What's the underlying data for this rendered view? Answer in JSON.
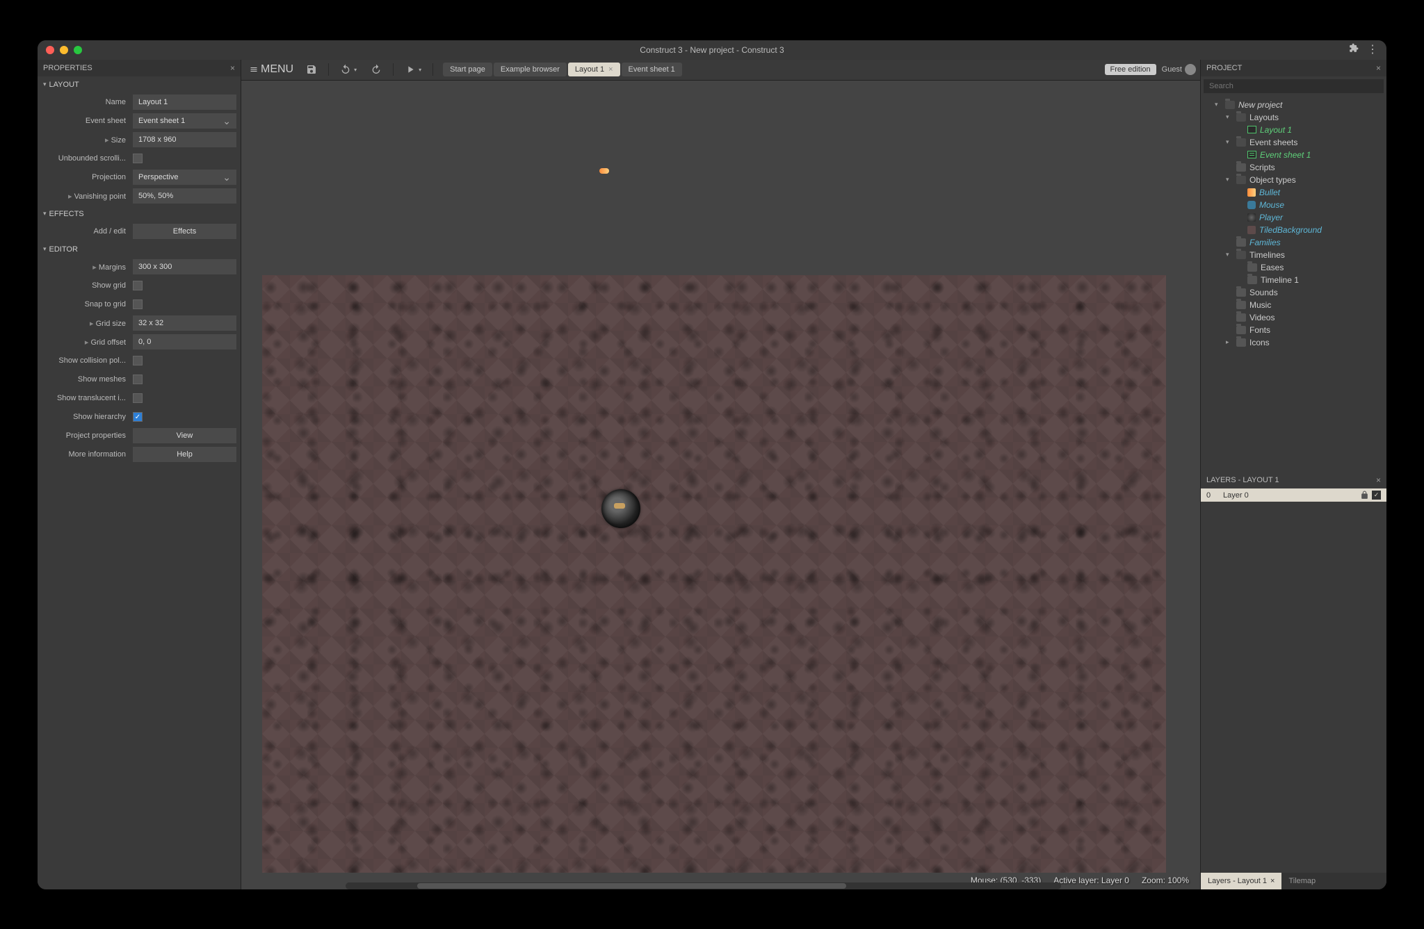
{
  "window": {
    "title": "Construct 3 - New project - Construct 3"
  },
  "properties": {
    "title": "PROPERTIES",
    "sections": {
      "layout": {
        "title": "LAYOUT",
        "name_label": "Name",
        "name_value": "Layout 1",
        "eventsheet_label": "Event sheet",
        "eventsheet_value": "Event sheet 1",
        "size_label": "Size",
        "size_value": "1708 x 960",
        "unbounded_label": "Unbounded scrolli...",
        "projection_label": "Projection",
        "projection_value": "Perspective",
        "vanishing_label": "Vanishing point",
        "vanishing_value": "50%, 50%"
      },
      "effects": {
        "title": "EFFECTS",
        "addedit_label": "Add / edit",
        "effects_btn": "Effects"
      },
      "editor": {
        "title": "EDITOR",
        "margins_label": "Margins",
        "margins_value": "300 x 300",
        "showgrid_label": "Show grid",
        "snap_label": "Snap to grid",
        "gridsize_label": "Grid size",
        "gridsize_value": "32 x 32",
        "gridoffset_label": "Grid offset",
        "gridoffset_value": "0, 0",
        "collision_label": "Show collision pol...",
        "meshes_label": "Show meshes",
        "translucent_label": "Show translucent i...",
        "hierarchy_label": "Show hierarchy",
        "projprops_label": "Project properties",
        "view_btn": "View",
        "moreinfo_label": "More information",
        "help_btn": "Help"
      }
    }
  },
  "toolbar": {
    "menu": "MENU",
    "tabs": {
      "start": "Start page",
      "examples": "Example browser",
      "layout": "Layout 1",
      "event": "Event sheet 1"
    },
    "free": "Free edition",
    "guest": "Guest"
  },
  "status": {
    "mouse": "Mouse: (530, -333)",
    "layer": "Active layer: Layer 0",
    "zoom": "Zoom: 100%"
  },
  "project_panel": {
    "title": "PROJECT",
    "search_placeholder": "Search",
    "root": "New project",
    "layouts": "Layouts",
    "layout1": "Layout 1",
    "eventsheets": "Event sheets",
    "eventsheet1": "Event sheet 1",
    "scripts": "Scripts",
    "objtypes": "Object types",
    "obj_bullet": "Bullet",
    "obj_mouse": "Mouse",
    "obj_player": "Player",
    "obj_tiled": "TiledBackground",
    "families": "Families",
    "timelines": "Timelines",
    "eases": "Eases",
    "timeline1": "Timeline 1",
    "sounds": "Sounds",
    "music": "Music",
    "videos": "Videos",
    "fonts": "Fonts",
    "icons": "Icons"
  },
  "layers_panel": {
    "title": "LAYERS - LAYOUT 1",
    "layer_num": "0",
    "layer_name": "Layer 0",
    "tab_layers": "Layers - Layout 1",
    "tab_tilemap": "Tilemap"
  }
}
